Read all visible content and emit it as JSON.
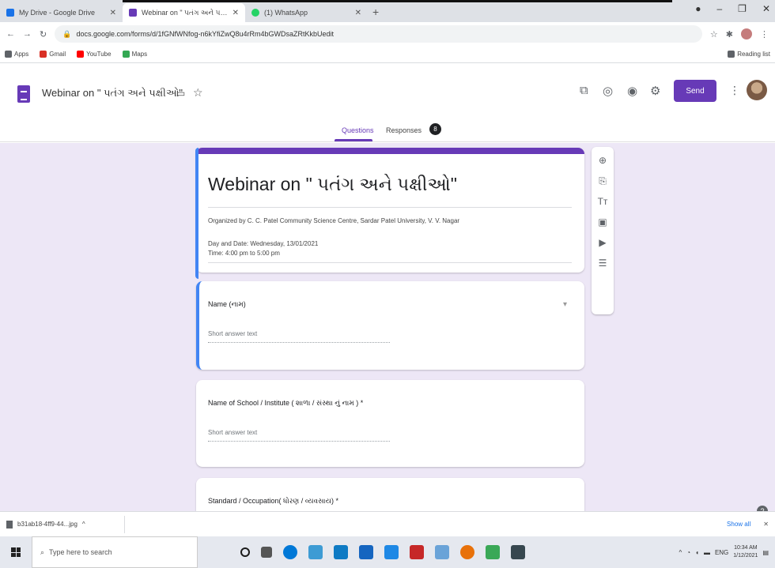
{
  "browser": {
    "tabs": [
      {
        "title": "My Drive - Google Drive",
        "color": "#1a73e8",
        "active": false
      },
      {
        "title": "Webinar on \" પતંગ અને પક્ષીઓ\"",
        "color": "#673ab7",
        "active": true
      },
      {
        "title": "(1) WhatsApp",
        "color": "#25d366",
        "active": false
      }
    ],
    "url": "docs.google.com/forms/d/1fGNfWNfog-n6kYfiZwQ8u4rRm4bGWDsaZRtKkbUedit",
    "bookmarks": [
      "Apps",
      "Gmail",
      "YouTube",
      "Maps"
    ],
    "reading_list": "Reading list"
  },
  "form_header": {
    "title": "Webinar on \" પતંગ અને પક્ષીઓ\"",
    "send_label": "Send",
    "tab_questions": "Questions",
    "tab_responses": "Responses",
    "responses_count": "8",
    "accent_color": "#673ab7"
  },
  "form": {
    "title": "Webinar on \" પતંગ અને પક્ષીઓ\"",
    "description_1": "Organized by C. C. Patel Community Science Centre, Sardar Patel University, V. V. Nagar",
    "description_2": "Day and Date: Wednesday, 13/01/2021",
    "description_3": "Time: 4:00 pm to 5:00 pm",
    "questions": [
      {
        "label": "Name (નામ)",
        "placeholder": "Short answer text"
      },
      {
        "label": "Name of School / Institute ( શાળા / સંસ્થા નું નામ ) *",
        "placeholder": "Short answer text"
      },
      {
        "label": "Standard / Occupation( ધોરણ / વ્યવસાય) *"
      }
    ]
  },
  "downloads": {
    "file": "b31ab18-4ff9-44...jpg",
    "show_all": "Show all"
  },
  "taskbar": {
    "search_placeholder": "Type here to search",
    "time": "10:34 AM",
    "date": "1/12/2021"
  }
}
